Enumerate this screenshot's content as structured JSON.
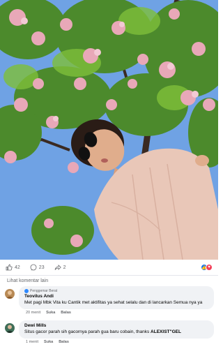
{
  "photo": {
    "alt_subject": "woman-under-cherry-blossoms"
  },
  "reactions": {
    "likes": "42",
    "comments": "23",
    "shares": "2"
  },
  "more_comments_label": "Lihat komentar lain",
  "comments": [
    {
      "badge": "Penggemar Berat",
      "author": "Teovilus Andi",
      "text": "Met pagi Mbk Vita ku Cantik met aktifitas ya sehat selalu dan di lancarkan Semua nya ya",
      "time": "20 menit",
      "like_label": "Suka",
      "reply_label": "Balas"
    },
    {
      "author": "Dewi Mills",
      "text_prefix": "Situs gacor parah sih gacornya parah gua baru cobain, thanks ",
      "text_bold": "ALEXIST\"GEL",
      "time": "1 menit",
      "like_label": "Suka",
      "reply_label": "Balas"
    }
  ],
  "colors": {
    "like": "#1877f2",
    "love": "#f33e58",
    "bubble": "#f0f2f5",
    "muted_text": "#65676b"
  }
}
